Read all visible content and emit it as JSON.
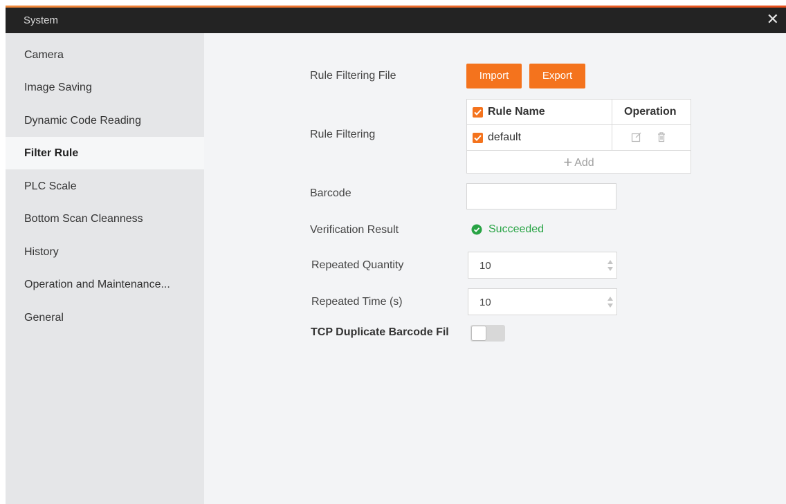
{
  "window": {
    "title": "System",
    "close_glyph": "✕"
  },
  "sidebar": {
    "items": [
      {
        "label": "Camera",
        "active": false
      },
      {
        "label": "Image Saving",
        "active": false
      },
      {
        "label": "Dynamic Code Reading",
        "active": false
      },
      {
        "label": "Filter Rule",
        "active": true
      },
      {
        "label": "PLC Scale",
        "active": false
      },
      {
        "label": "Bottom Scan Cleanness",
        "active": false
      },
      {
        "label": "History",
        "active": false
      },
      {
        "label": "Operation and Maintenance...",
        "active": false
      },
      {
        "label": "General",
        "active": false
      }
    ]
  },
  "form": {
    "rule_filtering_file": {
      "label": "Rule Filtering File",
      "import_label": "Import",
      "export_label": "Export"
    },
    "rule_filtering": {
      "label": "Rule Filtering",
      "table": {
        "headers": {
          "name": "Rule Name",
          "operation": "Operation"
        },
        "rows": [
          {
            "name": "default",
            "checked": true
          }
        ],
        "add_label": "Add",
        "icons": {
          "edit": "edit-icon",
          "delete": "trash-icon",
          "add": "plus-icon"
        }
      }
    },
    "barcode": {
      "label": "Barcode",
      "value": "",
      "placeholder": ""
    },
    "verification_result": {
      "label": "Verification Result",
      "status": "Succeeded",
      "icon": "check-circle-icon"
    },
    "repeated_quantity": {
      "label": "Repeated Quantity",
      "value": "10"
    },
    "repeated_time": {
      "label": "Repeated Time (s)",
      "value": "10"
    },
    "tcp_duplicate": {
      "label": "TCP Duplicate Barcode Fil",
      "enabled": false
    }
  },
  "colors": {
    "accent": "#f4731d",
    "success": "#27a344",
    "titlebar_bg": "#232323",
    "sidebar_bg": "#e5e6e8",
    "content_bg": "#f3f4f6"
  }
}
